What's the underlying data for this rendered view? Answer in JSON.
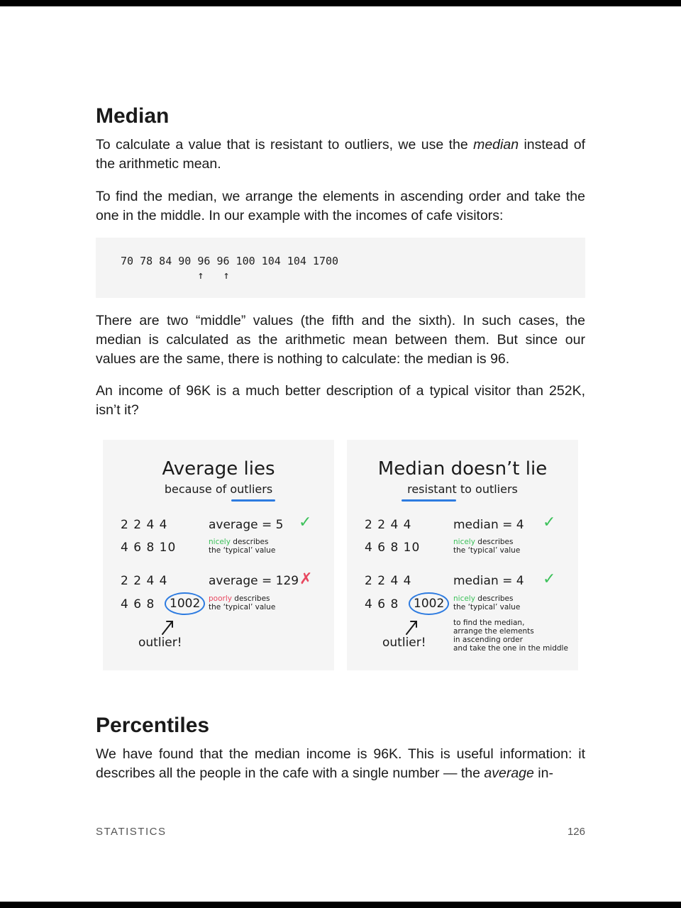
{
  "heading_median": "Median",
  "p1": [
    "To calculate a value that is resistant to outliers, we use the ",
    "median",
    " instead of the arithmetic mean."
  ],
  "p2": "To find the median, we arrange the elements in ascending order and take the one in the middle. In our example with the incomes of cafe visitors:",
  "code": {
    "line1": "70 78 84 90 96 96 100 104 104 1700",
    "line2": "            ↑   ↑"
  },
  "p3": "There are two “middle” values (the fifth and the sixth). In such cases, the median is calculated as the arithmetic mean between them. But since our values are the same, there is nothing to calculate: the median is 96.",
  "p4": "An income of 96K is a much better description of a typical visitor than 252K, isn’t it?",
  "figure": {
    "left": {
      "title": "Average lies",
      "subtitle_pre": "because of ",
      "subtitle_key": "outliers",
      "row1": "2 2 4 4",
      "row2": "4 6 8 10",
      "stat1": "average = 5",
      "note1_color": "nicely",
      "note1_rest": " describes",
      "note1_line2": "the ‘typical’ value",
      "row3": "2 2 4 4",
      "row4": "4 6 8",
      "outlier_value": "1002",
      "stat2": "average = 129",
      "note2_color": "poorly",
      "note2_rest": " describes",
      "note2_line2": "the ‘typical’ value",
      "outlier_label": "outlier!"
    },
    "right": {
      "title": "Median doesn’t lie",
      "subtitle_key": "resistant",
      "subtitle_post": " to outliers",
      "row1": "2 2 4 4",
      "row2": "4 6 8 10",
      "stat1": "median = 4",
      "note1_color": "nicely",
      "note1_rest": " describes",
      "note1_line2": "the ‘typical’ value",
      "row3": "2 2 4 4",
      "row4": "4 6 8",
      "outlier_value": "1002",
      "stat2": "median = 4",
      "note2_color": "nicely",
      "note2_rest": " describes",
      "note2_line2": "the ‘typical’ value",
      "explain": [
        "to find the median,",
        "arrange the elements",
        "in ascending order",
        "and take the one in the middle"
      ],
      "outlier_label": "outlier!"
    }
  },
  "heading_percentiles": "Percentiles",
  "p5": [
    "We have found that the median income is 96K. This is useful information: it describes all the people in the cafe with a single number — the ",
    "average",
    " in-"
  ],
  "footer": {
    "section": "STATISTICS",
    "page": "126"
  },
  "colors": {
    "good": "#3cc15a",
    "bad": "#e8475f",
    "accent": "#2d7be0",
    "code_bg": "#f4f4f4"
  }
}
